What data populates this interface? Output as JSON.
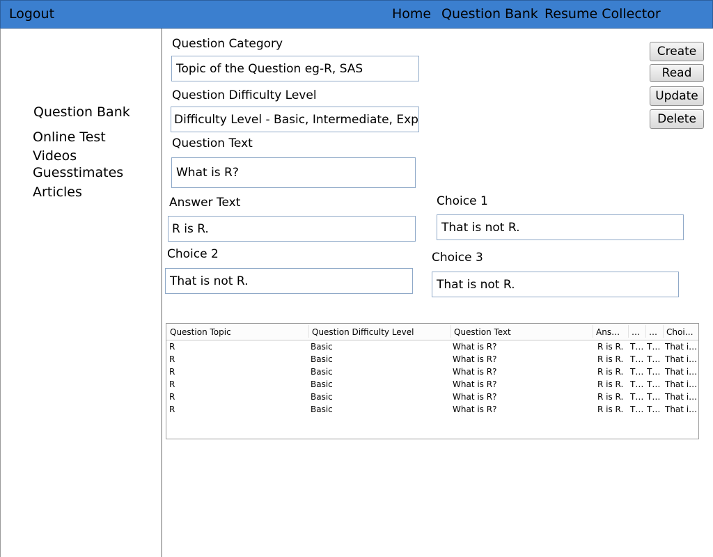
{
  "topbar": {
    "logout": "Logout",
    "home": "Home",
    "question_bank": "Question Bank",
    "resume_collector": "Resume Collector"
  },
  "sidebar": {
    "items": [
      {
        "label": "Question Bank"
      },
      {
        "label": "Online Test"
      },
      {
        "label": "Videos"
      },
      {
        "label": "Guesstimates"
      },
      {
        "label": "Articles"
      }
    ]
  },
  "form": {
    "category_label": "Question Category",
    "category_value": "Topic of the Question eg-R, SAS",
    "difficulty_label": "Question Difficulty Level",
    "difficulty_value": "Difficulty Level - Basic, Intermediate, Expert",
    "text_label": "Question Text",
    "text_value": "What is R?",
    "answer_label": "Answer Text",
    "answer_value": "R is R.",
    "choice1_label": "Choice 1",
    "choice1_value": "That is not R.",
    "choice2_label": "Choice 2",
    "choice2_value": "That is not R.",
    "choice3_label": "Choice 3",
    "choice3_value": "That is not R."
  },
  "actions": {
    "create": "Create",
    "read": "Read",
    "update": "Update",
    "delete": "Delete"
  },
  "table": {
    "columns": [
      "Question Topic",
      "Question Difficulty Level",
      "Question Text",
      "Ans…",
      "…",
      "…",
      "Choi…"
    ],
    "rows": [
      [
        "R",
        "Basic",
        "What is R?",
        "R is R.",
        "T…",
        "T…",
        "That i…"
      ],
      [
        "R",
        "Basic",
        "What is R?",
        "R is R.",
        "T…",
        "T…",
        "That i…"
      ],
      [
        "R",
        "Basic",
        "What is R?",
        "R is R.",
        "T…",
        "T…",
        "That i…"
      ],
      [
        "R",
        "Basic",
        "What is R?",
        "R is R.",
        "T…",
        "T…",
        "That i…"
      ],
      [
        "R",
        "Basic",
        "What is R?",
        "R is R.",
        "T…",
        "T…",
        "That i…"
      ],
      [
        "R",
        "Basic",
        "What is R?",
        "R is R.",
        "T…",
        "T…",
        "That i…"
      ]
    ]
  },
  "colors": {
    "topbar": "#3b7fcf",
    "field_border": "#8fa9c8"
  }
}
